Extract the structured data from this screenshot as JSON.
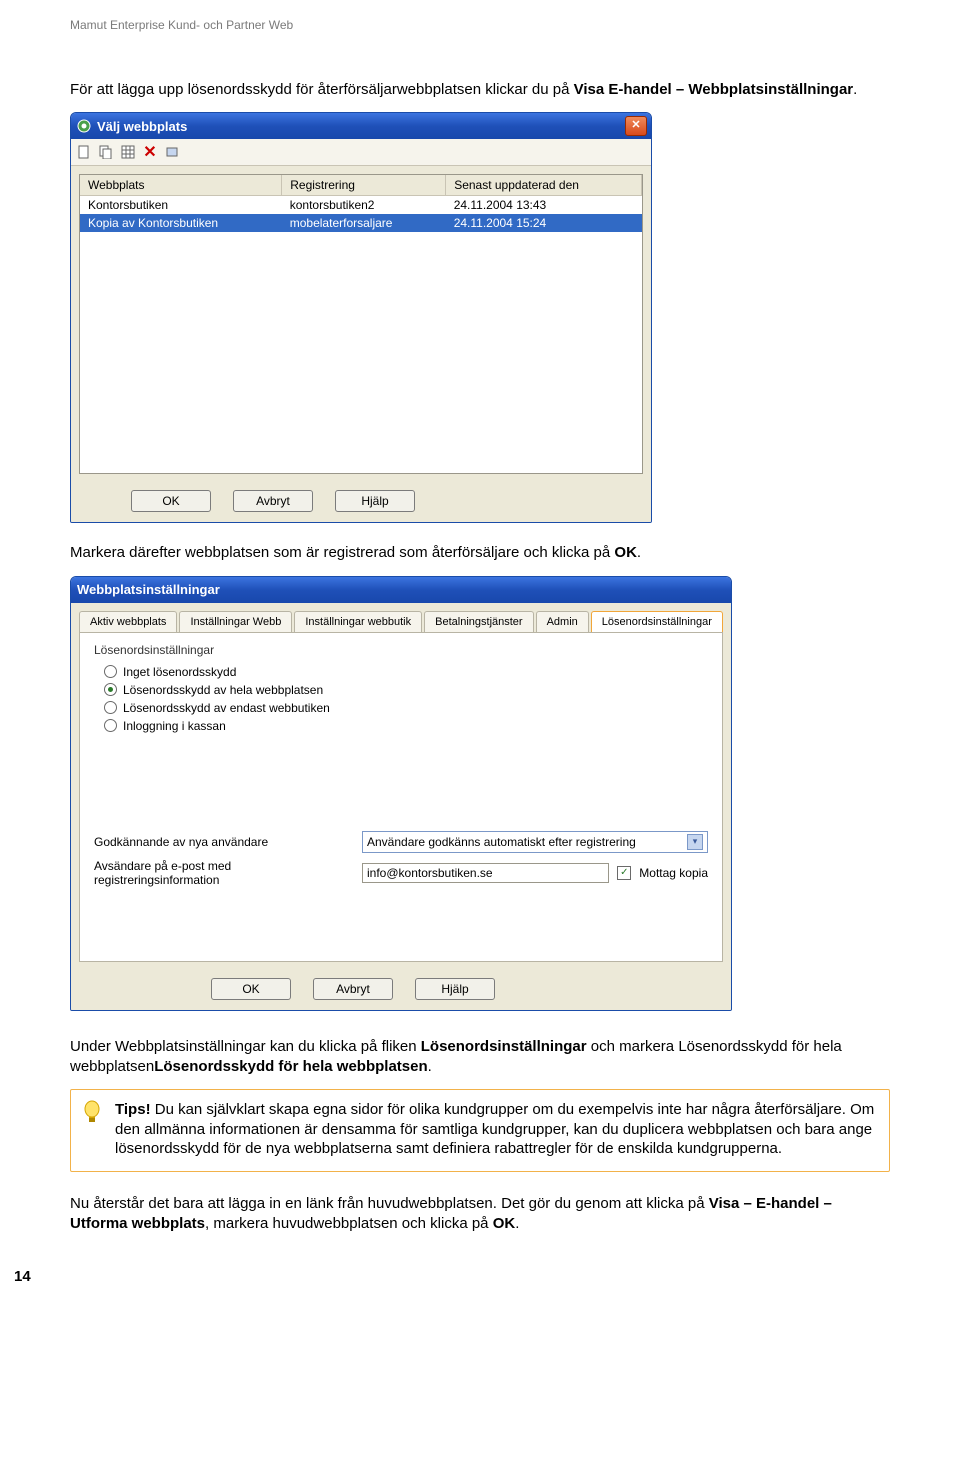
{
  "doc_header": "Mamut Enterprise Kund- och Partner Web",
  "para1_a": "För att lägga upp lösenordsskydd för återförsäljarwebbplatsen klickar du på ",
  "para1_b": "Visa E-handel – Webbplatsinställningar",
  "para1_c": ".",
  "dialog1": {
    "title": "Välj webbplats",
    "columns": [
      "Webbplats",
      "Registrering",
      "Senast uppdaterad den"
    ],
    "rows": [
      {
        "c0": "Kontorsbutiken",
        "c1": "kontorsbutiken2",
        "c2": "24.11.2004 13:43"
      },
      {
        "c0": "Kopia av Kontorsbutiken",
        "c1": "mobelaterforsaljare",
        "c2": "24.11.2004 15:24"
      }
    ],
    "ok": "OK",
    "cancel": "Avbryt",
    "help": "Hjälp"
  },
  "para2_a": "Markera därefter webbplatsen som är registrerad som återförsäljare och klicka på ",
  "para2_b": "OK",
  "para2_c": ".",
  "dialog2": {
    "title": "Webbplatsinställningar",
    "tabs": [
      "Aktiv webbplats",
      "Inställningar Webb",
      "Inställningar webbutik",
      "Betalningstjänster",
      "Admin",
      "Lösenordsinställningar"
    ],
    "panel_title": "Lösenordsinställningar",
    "radios": [
      "Inget lösenordsskydd",
      "Lösenordsskydd av hela webbplatsen",
      "Lösenordsskydd av endast webbutiken",
      "Inloggning i kassan"
    ],
    "radio_selected": 1,
    "approve_label": "Godkännande av nya användare",
    "approve_value": "Användare godkänns automatiskt efter registrering",
    "sender_label": "Avsändare på e-post med registreringsinformation",
    "sender_value": "info@kontorsbutiken.se",
    "copy_label": "Mottag kopia",
    "ok": "OK",
    "cancel": "Avbryt",
    "help": "Hjälp"
  },
  "para3_a": "Under Webbplatsinställningar kan du klicka på fliken ",
  "para3_b": "Lösenordsinställningar",
  "para3_c": " och markera ",
  "para3_d": "Lösenordsskydd för hela webbplatsen",
  "para3_e": ".",
  "tips": {
    "label": "Tips!",
    "body": " Du kan självklart skapa egna sidor för olika kundgrupper om du exempelvis inte har några återförsäljare. Om den allmänna informationen är densamma för samtliga kundgrupper, kan du duplicera webbplatsen och bara ange lösenordsskydd för de nya webbplatserna samt definiera rabattregler för de enskilda kundgrupperna."
  },
  "para4_a": "Nu återstår det bara att lägga in en länk från huvudwebbplatsen. Det gör du genom att klicka på ",
  "para4_b": "Visa – E-handel – Utforma webbplats",
  "para4_c": ", markera huvudwebbplatsen och klicka på ",
  "para4_d": "OK",
  "para4_e": ".",
  "page_number": "14"
}
